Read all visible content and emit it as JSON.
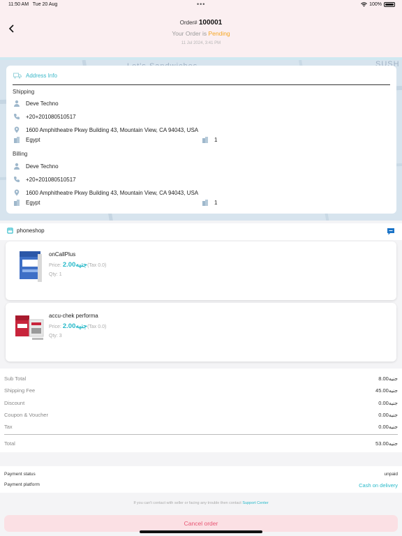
{
  "status_bar": {
    "time": "11:50 AM",
    "date": "Tue 20 Aug",
    "battery": "100%"
  },
  "header": {
    "order_prefix": "Order#",
    "order_number": "100001",
    "status_prefix": "Your Order is",
    "status": "Pending",
    "date": "11 Jul 2024, 3:41 PM"
  },
  "map": {
    "labels": [
      "Let's Sandwiches",
      "SUSH"
    ]
  },
  "address": {
    "title": "Address Info",
    "shipping": {
      "label": "Shipping",
      "name": "Deve Techno",
      "phone": "+20+201080510517",
      "street": "1600 Amphitheatre Pkwy Building 43, Mountain View, CA 94043, USA",
      "country": "Egypt",
      "unit": "1"
    },
    "billing": {
      "label": "Billing",
      "name": "Deve Techno",
      "phone": "+20+201080510517",
      "street": " 1600 Amphitheatre Pkwy Building 43, Mountain View, CA 94043, USA",
      "country": "Egypt",
      "unit": "1"
    }
  },
  "shop": {
    "name": "phoneshop"
  },
  "products": [
    {
      "name": "onCallPlus",
      "price_label": "Price:",
      "price": "2.00جنيه",
      "tax": "(Tax 0.0)",
      "qty": "Qty: 1"
    },
    {
      "name": "accu-chek performa",
      "price_label": "Price:",
      "price": "2.00جنيه",
      "tax": "(Tax 0.0)",
      "qty": "Qty: 3"
    }
  ],
  "totals": {
    "rows": [
      {
        "label": "Sub Total",
        "value": "8.00جنيه"
      },
      {
        "label": "Shipping Fee",
        "value": "45.00جنيه"
      },
      {
        "label": "Discount",
        "value": "0.00جنيه"
      },
      {
        "label": "Coupon & Voucher",
        "value": "0.00جنيه"
      },
      {
        "label": "Tax",
        "value": "0.00جنيه"
      }
    ],
    "total_label": "Total",
    "total_value": "53.00جنيه"
  },
  "payment": {
    "status_label": "Payment status",
    "status_value": "unpaid",
    "platform_label": "Payment platform",
    "platform_value": "Cash on delivery"
  },
  "support": {
    "text": "If you can't contact with seller or facing any trouble then contact",
    "link": "Support Center"
  },
  "cancel_label": "Cancel order",
  "colors": {
    "accent": "#27b9c9",
    "pending": "#f5a623",
    "danger": "#e85472",
    "header_bg": "#fbeff1"
  }
}
